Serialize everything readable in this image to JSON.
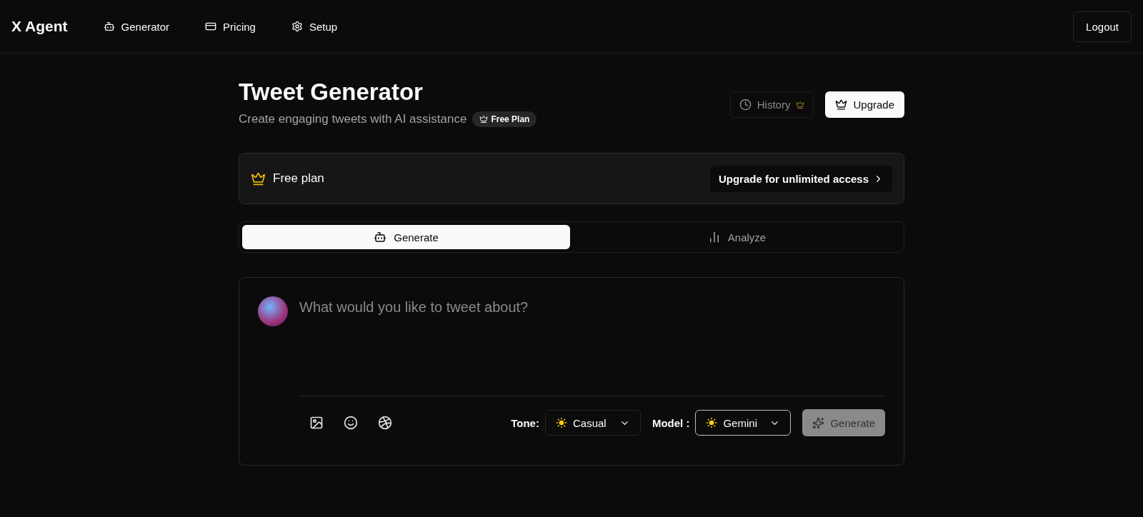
{
  "header": {
    "logo": "X Agent",
    "nav": [
      {
        "label": "Generator"
      },
      {
        "label": "Pricing"
      },
      {
        "label": "Setup"
      }
    ],
    "logout": "Logout"
  },
  "title": "Tweet Generator",
  "subtitle": "Create engaging tweets with AI assistance",
  "plan_badge": "Free Plan",
  "history_button": {
    "label": "History",
    "disabled": true
  },
  "upgrade_button": "Upgrade",
  "plan_banner": {
    "label": "Free plan",
    "action": "Upgrade for unlimited access"
  },
  "tabs": [
    {
      "label": "Generate",
      "selected": true
    },
    {
      "label": "Analyze",
      "selected": false
    }
  ],
  "composer": {
    "placeholder": "What would you like to tweet about?",
    "tone_label": "Tone:",
    "tone": "Casual",
    "model_label": "Model :",
    "model": "Gemini",
    "generate": {
      "label": "Generate",
      "disabled": true
    }
  }
}
